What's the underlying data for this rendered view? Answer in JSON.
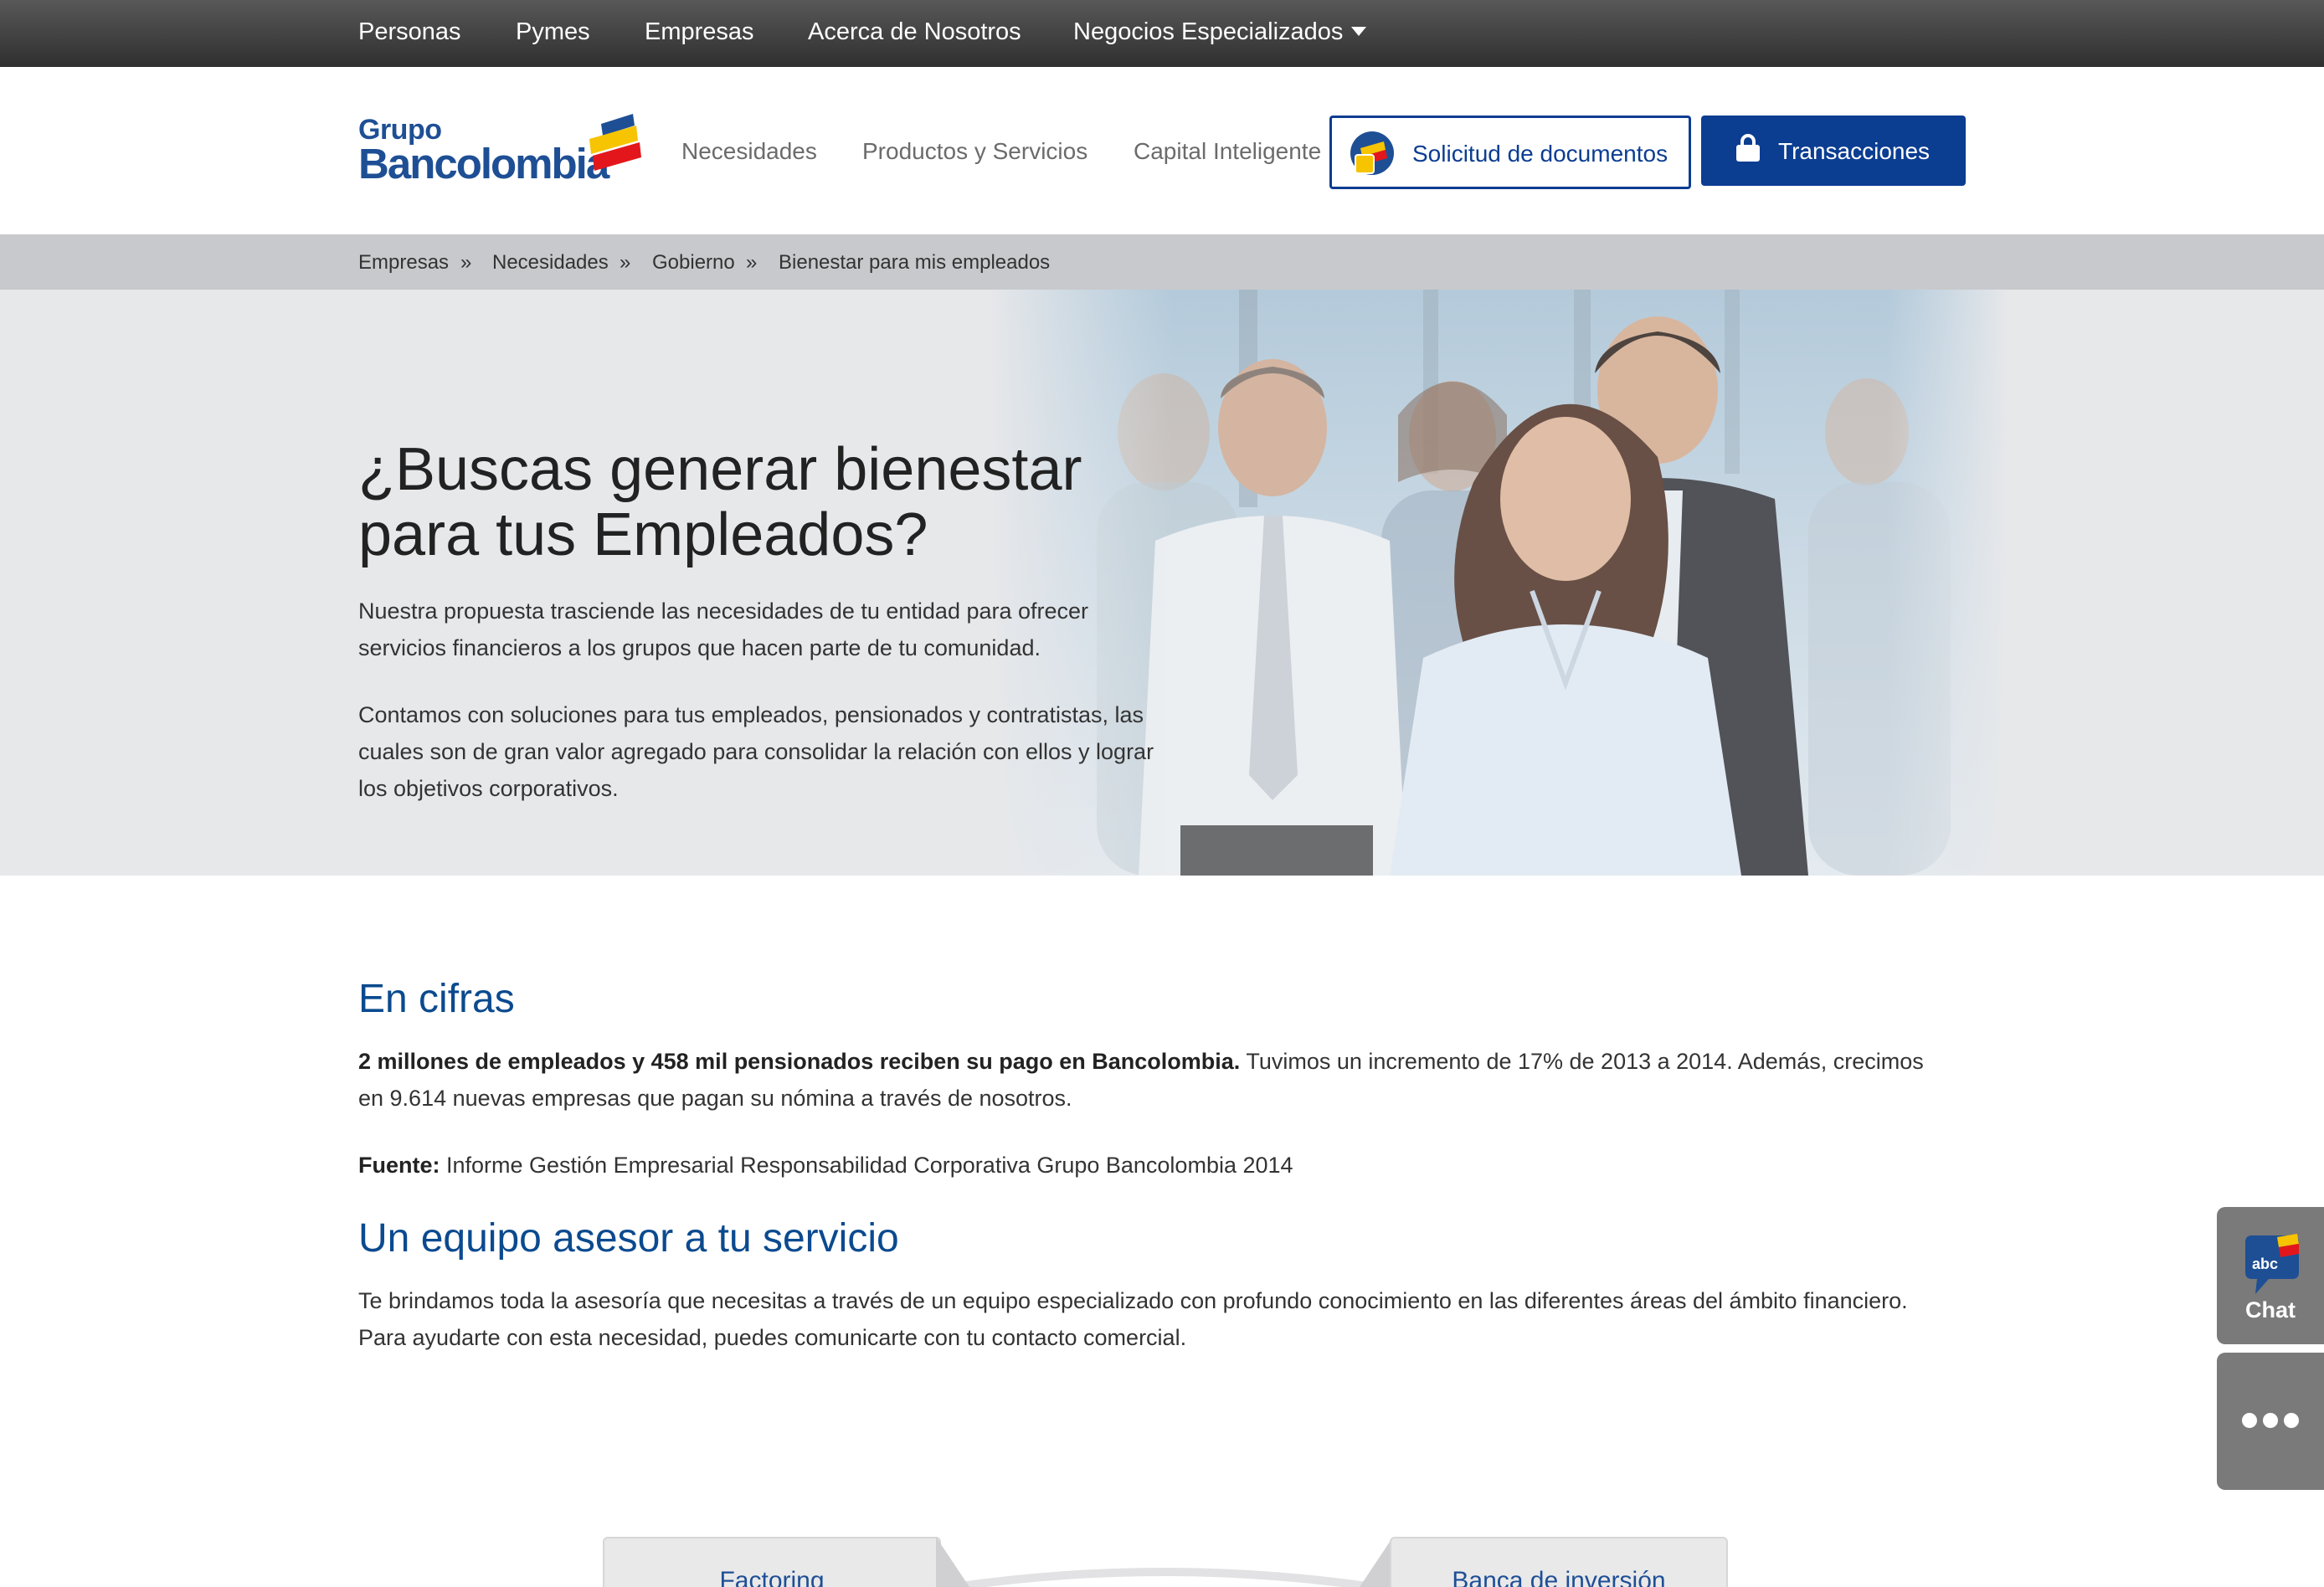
{
  "topnav": {
    "items": [
      "Personas",
      "Pymes",
      "Empresas",
      "Acerca de Nosotros",
      "Negocios Especializados"
    ]
  },
  "header": {
    "logo_line1": "Grupo",
    "logo_line2": "Bancolombia",
    "nav": [
      "Necesidades",
      "Productos y Servicios",
      "Capital Inteligente"
    ],
    "docs_button": "Solicitud de documentos",
    "transactions_button": "Transacciones"
  },
  "breadcrumb": {
    "items": [
      "Empresas",
      "Necesidades",
      "Gobierno",
      "Bienestar para mis empleados"
    ],
    "separator": "»"
  },
  "hero": {
    "title_line1": "¿Buscas generar bienestar",
    "title_line2": "para tus Empleados?",
    "p1": "Nuestra propuesta trasciende las necesidades de tu entidad para ofrecer servicios financieros a los grupos que hacen parte de tu comunidad.",
    "p2": "Contamos con soluciones para tus empleados, pensionados y contratistas, las cuales son de gran valor agregado para consolidar la relación con ellos y lograr los objetivos corporativos."
  },
  "cifras": {
    "title": "En cifras",
    "bold": "2 millones de empleados y 458 mil pensionados reciben su pago en Bancolombia.",
    "text": " Tuvimos un incremento de 17% de 2013 a 2014. Además, crecimos en 9.614 nuevas empresas que pagan su nómina a través de nosotros.",
    "source_label": "Fuente:",
    "source_text": " Informe Gestión Empresarial Responsabilidad Corporativa Grupo Bancolombia 2014"
  },
  "asesor": {
    "title": "Un equipo asesor a tu servicio",
    "text": "Te brindamos toda la asesoría que necesitas a través de un equipo especializado con profundo conocimiento en las diferentes áreas del ámbito financiero. Para ayudarte con esta necesidad, puedes comunicarte con tu contacto comercial."
  },
  "tabs": [
    "Factoring",
    "Banca de inversión"
  ],
  "side": {
    "chat_badge": "abc",
    "chat_label": "Chat"
  },
  "colors": {
    "brand_blue": "#0b3d91",
    "heading_blue": "#0b4a8f",
    "logo_yellow": "#f6c400",
    "logo_red": "#e3171b"
  }
}
